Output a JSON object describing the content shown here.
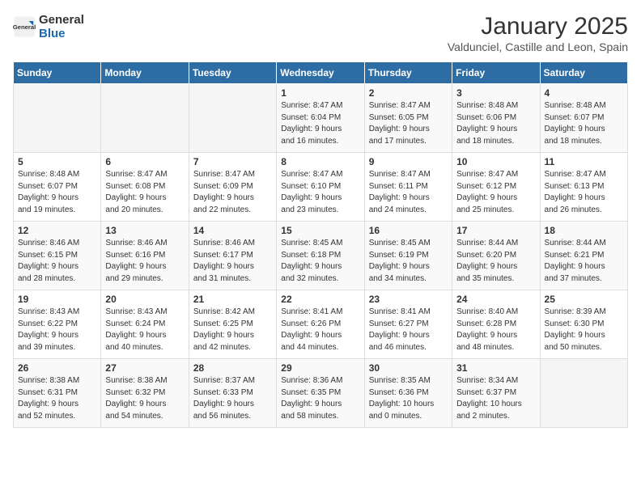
{
  "header": {
    "logo_general": "General",
    "logo_blue": "Blue",
    "title": "January 2025",
    "subtitle": "Valdunciel, Castille and Leon, Spain"
  },
  "weekdays": [
    "Sunday",
    "Monday",
    "Tuesday",
    "Wednesday",
    "Thursday",
    "Friday",
    "Saturday"
  ],
  "weeks": [
    [
      {
        "day": "",
        "info": ""
      },
      {
        "day": "",
        "info": ""
      },
      {
        "day": "",
        "info": ""
      },
      {
        "day": "1",
        "info": "Sunrise: 8:47 AM\nSunset: 6:04 PM\nDaylight: 9 hours\nand 16 minutes."
      },
      {
        "day": "2",
        "info": "Sunrise: 8:47 AM\nSunset: 6:05 PM\nDaylight: 9 hours\nand 17 minutes."
      },
      {
        "day": "3",
        "info": "Sunrise: 8:48 AM\nSunset: 6:06 PM\nDaylight: 9 hours\nand 18 minutes."
      },
      {
        "day": "4",
        "info": "Sunrise: 8:48 AM\nSunset: 6:07 PM\nDaylight: 9 hours\nand 18 minutes."
      }
    ],
    [
      {
        "day": "5",
        "info": "Sunrise: 8:48 AM\nSunset: 6:07 PM\nDaylight: 9 hours\nand 19 minutes."
      },
      {
        "day": "6",
        "info": "Sunrise: 8:47 AM\nSunset: 6:08 PM\nDaylight: 9 hours\nand 20 minutes."
      },
      {
        "day": "7",
        "info": "Sunrise: 8:47 AM\nSunset: 6:09 PM\nDaylight: 9 hours\nand 22 minutes."
      },
      {
        "day": "8",
        "info": "Sunrise: 8:47 AM\nSunset: 6:10 PM\nDaylight: 9 hours\nand 23 minutes."
      },
      {
        "day": "9",
        "info": "Sunrise: 8:47 AM\nSunset: 6:11 PM\nDaylight: 9 hours\nand 24 minutes."
      },
      {
        "day": "10",
        "info": "Sunrise: 8:47 AM\nSunset: 6:12 PM\nDaylight: 9 hours\nand 25 minutes."
      },
      {
        "day": "11",
        "info": "Sunrise: 8:47 AM\nSunset: 6:13 PM\nDaylight: 9 hours\nand 26 minutes."
      }
    ],
    [
      {
        "day": "12",
        "info": "Sunrise: 8:46 AM\nSunset: 6:15 PM\nDaylight: 9 hours\nand 28 minutes."
      },
      {
        "day": "13",
        "info": "Sunrise: 8:46 AM\nSunset: 6:16 PM\nDaylight: 9 hours\nand 29 minutes."
      },
      {
        "day": "14",
        "info": "Sunrise: 8:46 AM\nSunset: 6:17 PM\nDaylight: 9 hours\nand 31 minutes."
      },
      {
        "day": "15",
        "info": "Sunrise: 8:45 AM\nSunset: 6:18 PM\nDaylight: 9 hours\nand 32 minutes."
      },
      {
        "day": "16",
        "info": "Sunrise: 8:45 AM\nSunset: 6:19 PM\nDaylight: 9 hours\nand 34 minutes."
      },
      {
        "day": "17",
        "info": "Sunrise: 8:44 AM\nSunset: 6:20 PM\nDaylight: 9 hours\nand 35 minutes."
      },
      {
        "day": "18",
        "info": "Sunrise: 8:44 AM\nSunset: 6:21 PM\nDaylight: 9 hours\nand 37 minutes."
      }
    ],
    [
      {
        "day": "19",
        "info": "Sunrise: 8:43 AM\nSunset: 6:22 PM\nDaylight: 9 hours\nand 39 minutes."
      },
      {
        "day": "20",
        "info": "Sunrise: 8:43 AM\nSunset: 6:24 PM\nDaylight: 9 hours\nand 40 minutes."
      },
      {
        "day": "21",
        "info": "Sunrise: 8:42 AM\nSunset: 6:25 PM\nDaylight: 9 hours\nand 42 minutes."
      },
      {
        "day": "22",
        "info": "Sunrise: 8:41 AM\nSunset: 6:26 PM\nDaylight: 9 hours\nand 44 minutes."
      },
      {
        "day": "23",
        "info": "Sunrise: 8:41 AM\nSunset: 6:27 PM\nDaylight: 9 hours\nand 46 minutes."
      },
      {
        "day": "24",
        "info": "Sunrise: 8:40 AM\nSunset: 6:28 PM\nDaylight: 9 hours\nand 48 minutes."
      },
      {
        "day": "25",
        "info": "Sunrise: 8:39 AM\nSunset: 6:30 PM\nDaylight: 9 hours\nand 50 minutes."
      }
    ],
    [
      {
        "day": "26",
        "info": "Sunrise: 8:38 AM\nSunset: 6:31 PM\nDaylight: 9 hours\nand 52 minutes."
      },
      {
        "day": "27",
        "info": "Sunrise: 8:38 AM\nSunset: 6:32 PM\nDaylight: 9 hours\nand 54 minutes."
      },
      {
        "day": "28",
        "info": "Sunrise: 8:37 AM\nSunset: 6:33 PM\nDaylight: 9 hours\nand 56 minutes."
      },
      {
        "day": "29",
        "info": "Sunrise: 8:36 AM\nSunset: 6:35 PM\nDaylight: 9 hours\nand 58 minutes."
      },
      {
        "day": "30",
        "info": "Sunrise: 8:35 AM\nSunset: 6:36 PM\nDaylight: 10 hours\nand 0 minutes."
      },
      {
        "day": "31",
        "info": "Sunrise: 8:34 AM\nSunset: 6:37 PM\nDaylight: 10 hours\nand 2 minutes."
      },
      {
        "day": "",
        "info": ""
      }
    ]
  ]
}
